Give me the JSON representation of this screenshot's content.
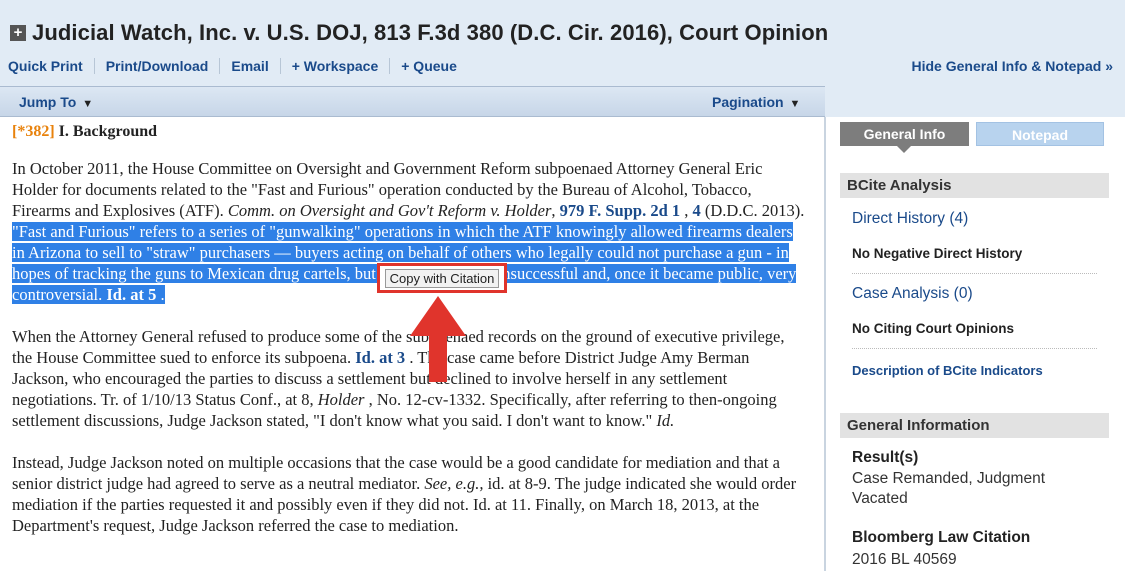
{
  "header": {
    "expand_glyph": "+",
    "title": "Judicial Watch, Inc. v. U.S. DOJ, 813 F.3d 380 (D.C. Cir. 2016), Court Opinion"
  },
  "actions": {
    "quick_print": "Quick Print",
    "print_download": "Print/Download",
    "email": "Email",
    "workspace": "+ Workspace",
    "queue": "+ Queue",
    "hide_panel": "Hide General Info & Notepad",
    "hide_panel_glyph": "»"
  },
  "nav": {
    "jump_to": "Jump To",
    "pagination": "Pagination",
    "caret": "▼"
  },
  "opinion": {
    "page_marker": "[*382]",
    "section_title": "I. Background",
    "p1": {
      "t1": "In October 2011, the House Committee on Oversight and Government Reform subpoenaed Attorney General Eric Holder for documents related to the \"Fast and Furious\" operation conducted by the Bureau of Alcohol, Tobacco, Firearms and Explosives (ATF). ",
      "case_name": "Comm. on Oversight and Gov't Reform v. Holder",
      "comma": ", ",
      "cite": "979 F. Supp. 2d 1",
      "sep": " , ",
      "cite_page": "4",
      "t2": " (D.D.C. 2013).",
      "hl_text": " \"Fast and Furious\" refers to a series of \"gunwalking\" operations in which the ATF knowingly allowed firearms dealers in Arizona to sell to \"straw\" purchasers — buyers acting on behalf of others who legally could not purchase a gun - in hopes of tracking the guns to Mexican drug cartels, but the program was unsuccessful and, once it became public, very controversial. ",
      "hl_cite": "Id. at 5",
      "hl_end": " ."
    },
    "p2": {
      "t1": "When the Attorney General refused to produce some of the subpoenaed records on the ground of executive privilege, the House Committee sued to enforce its subpoena. ",
      "cite": "Id. at 3",
      "t2": " . The case came before District Judge Amy Berman Jackson, who encouraged the parties to discuss a settlement but declined to involve herself in any settlement negotiations. Tr. of 1/10/13 Status Conf., at 8, ",
      "holder": "Holder",
      "t3": " , No. 12-cv-1332. Specifically, after referring to then-ongoing settlement discussions, Judge Jackson stated, \"I don't know what you said. I don't want to know.\" ",
      "id": "Id."
    },
    "p3": {
      "t1": "Instead, Judge Jackson noted on multiple occasions that the case would be a good candidate for mediation and that a senior district judge had agreed to serve as a neutral mediator. ",
      "see": "See, e.g.,",
      "t2": " id. at 8-9. The judge indicated she would order mediation if the parties requested it and possibly even if they did not. Id. at 11. Finally, on March 18, 2013, at the Department's request, Judge Jackson referred the case to mediation."
    }
  },
  "tooltip": {
    "label": "Copy with Citation"
  },
  "sidebar": {
    "tab_general": "General Info",
    "tab_notepad": "Notepad",
    "bcite_header": "BCite Analysis",
    "direct_history": "Direct History (4)",
    "no_negative": "No Negative Direct History",
    "case_analysis": "Case Analysis (0)",
    "no_citing": "No Citing Court Opinions",
    "description_link": "Description of BCite Indicators",
    "general_header": "General Information",
    "results_label": "Result(s)",
    "results_value": "Case Remanded, Judgment Vacated",
    "citation_label": "Bloomberg Law Citation",
    "citation_value": "2016 BL 40569"
  },
  "colors": {
    "highlight": "#2f80e6",
    "arrow": "#e0342c",
    "link": "#1a4a8a",
    "page_marker": "#e8820c"
  }
}
